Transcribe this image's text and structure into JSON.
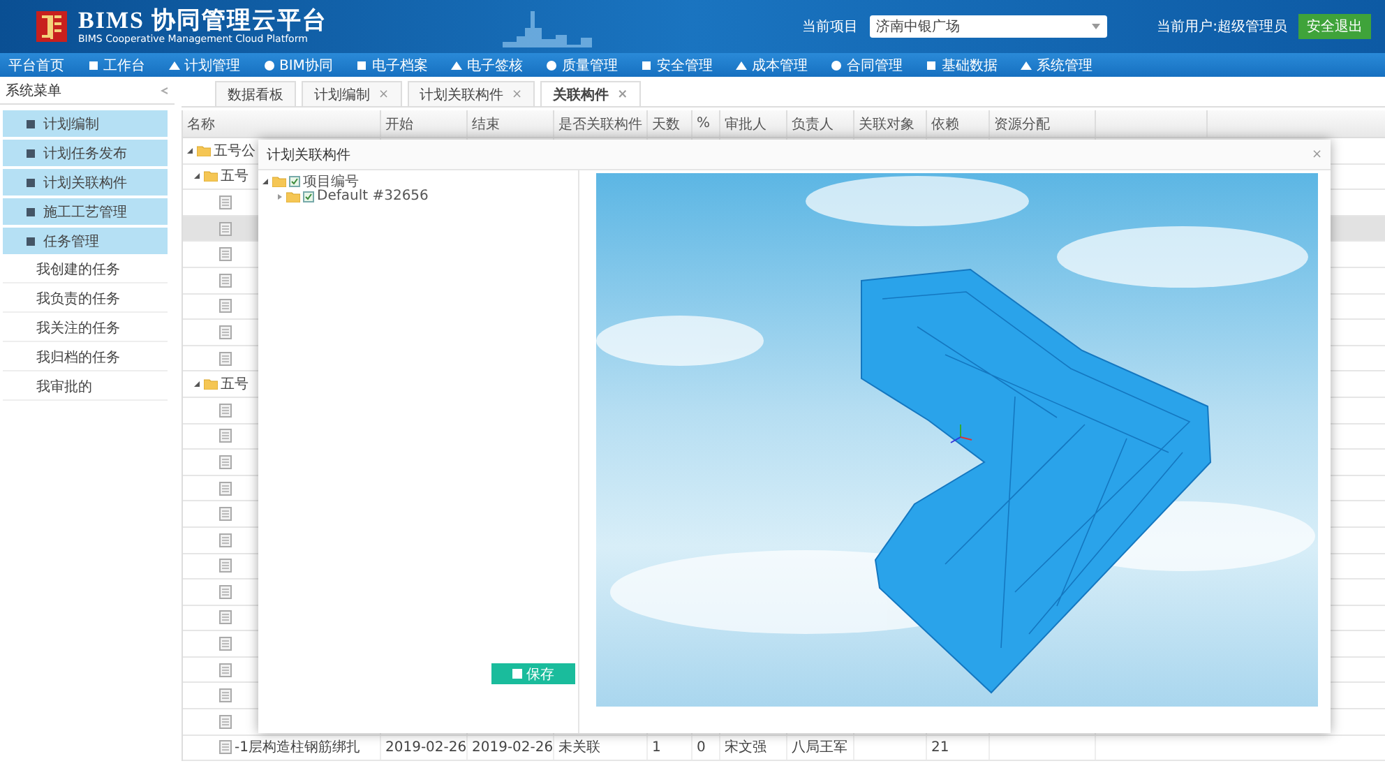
{
  "header": {
    "title": "BIMS 协同管理云平台",
    "subtitle": "BIMS Cooperative Management Cloud Platform",
    "project_label": "当前项目",
    "project_value": "济南中银广场",
    "user": "当前用户:超级管理员",
    "logout": "安全退出"
  },
  "nav": [
    "平台首页",
    "工作台",
    "计划管理",
    "BIM协同",
    "电子档案",
    "电子签核",
    "质量管理",
    "安全管理",
    "成本管理",
    "合同管理",
    "基础数据",
    "系统管理"
  ],
  "sidebar": {
    "title": "系统菜单",
    "items": [
      {
        "kind": "main",
        "label": "计划编制"
      },
      {
        "kind": "main",
        "label": "计划任务发布"
      },
      {
        "kind": "main",
        "label": "计划关联构件"
      },
      {
        "kind": "main",
        "label": "施工工艺管理"
      },
      {
        "kind": "main",
        "label": "任务管理"
      },
      {
        "kind": "sub",
        "label": "我创建的任务"
      },
      {
        "kind": "sub",
        "label": "我负责的任务"
      },
      {
        "kind": "sub",
        "label": "我关注的任务"
      },
      {
        "kind": "sub",
        "label": "我归档的任务"
      },
      {
        "kind": "sub",
        "label": "我审批的"
      }
    ]
  },
  "tabs": [
    {
      "label": "数据看板",
      "selected": false
    },
    {
      "label": "计划编制",
      "selected": false,
      "close": "×"
    },
    {
      "label": "计划关联构件",
      "selected": false,
      "close": "×"
    },
    {
      "label": "关联构件",
      "selected": true,
      "close": "×"
    }
  ],
  "table": {
    "columns": [
      "名称",
      "开始",
      "结束",
      "是否关联构件",
      "天数",
      "%",
      "审批人",
      "负责人",
      "关联对象",
      "依赖",
      "资源分配"
    ],
    "rows": [
      {
        "kind": "group",
        "name": "五号公",
        "expanded": true,
        "selected": false,
        "children": [
          {
            "kind": "group",
            "name": "五号",
            "expanded": true,
            "selected": false,
            "children": [
              {
                "kind": "task",
                "selected": false
              },
              {
                "kind": "task",
                "selected": true
              },
              {
                "kind": "task",
                "selected": false
              },
              {
                "kind": "task",
                "selected": false
              },
              {
                "kind": "task",
                "selected": false
              },
              {
                "kind": "task",
                "selected": false
              },
              {
                "kind": "task",
                "selected": false
              }
            ]
          },
          {
            "kind": "group",
            "name": "五号",
            "expanded": true,
            "selected": false,
            "children": [
              {
                "kind": "task",
                "selected": false
              },
              {
                "kind": "task",
                "selected": false
              },
              {
                "kind": "task",
                "selected": false
              },
              {
                "kind": "task",
                "selected": false
              },
              {
                "kind": "task",
                "selected": false
              },
              {
                "kind": "task",
                "selected": false
              },
              {
                "kind": "task",
                "selected": false
              },
              {
                "kind": "task",
                "selected": false
              },
              {
                "kind": "task",
                "selected": false
              },
              {
                "kind": "task",
                "selected": false
              },
              {
                "kind": "task",
                "selected": false
              },
              {
                "kind": "task",
                "selected": false
              },
              {
                "kind": "task",
                "selected": false
              },
              {
                "kind": "task",
                "selected": false,
                "name": "-1层构造柱钢筋绑扎",
                "cells": [
                  "2019-02-26",
                  "2019-02-26",
                  "未关联",
                  "1",
                  "0",
                  "宋文强",
                  "八局王军",
                  "",
                  "21"
                ]
              }
            ]
          }
        ]
      }
    ]
  },
  "dialog": {
    "title": "计划关联构件",
    "close": "×",
    "tree": [
      {
        "label": "项目编号",
        "checked": true,
        "expanded": true,
        "children": [
          {
            "label": "Default #32656",
            "checked": true,
            "expanded": false
          }
        ]
      }
    ],
    "save": "保存"
  }
}
